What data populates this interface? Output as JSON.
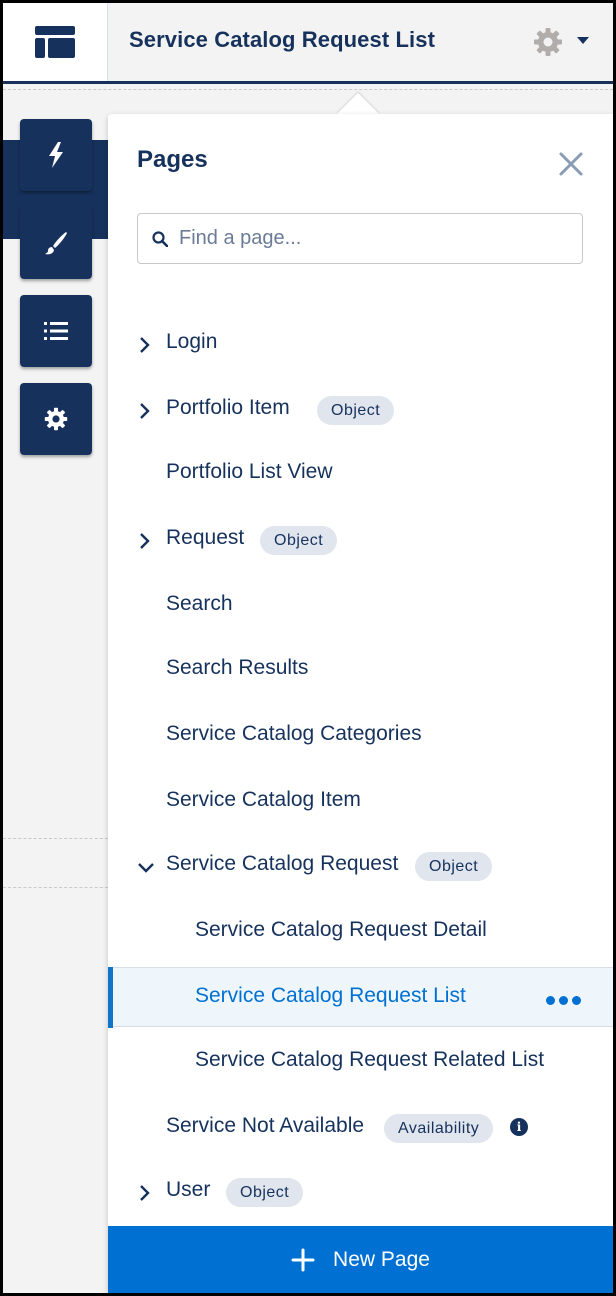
{
  "header": {
    "title": "Service Catalog Request List"
  },
  "toolbar": {
    "buttons": [
      {
        "icon": "lightning-icon"
      },
      {
        "icon": "paintbrush-icon"
      },
      {
        "icon": "list-icon"
      },
      {
        "icon": "gear-icon"
      }
    ]
  },
  "pages_panel": {
    "title": "Pages",
    "search": {
      "placeholder": "Find a page...",
      "value": ""
    },
    "items": [
      {
        "label": "Login",
        "expandable": true,
        "expanded": false,
        "indent": 0
      },
      {
        "label": "Portfolio Item",
        "badge": "Object",
        "expandable": true,
        "expanded": false,
        "indent": 0
      },
      {
        "label": "Portfolio List View",
        "expandable": false,
        "indent": 0
      },
      {
        "label": "Request",
        "badge": "Object",
        "expandable": true,
        "expanded": false,
        "indent": 0
      },
      {
        "label": "Search",
        "expandable": false,
        "indent": 0
      },
      {
        "label": "Search Results",
        "expandable": false,
        "indent": 0
      },
      {
        "label": "Service Catalog Categories",
        "expandable": false,
        "indent": 0
      },
      {
        "label": "Service Catalog Item",
        "expandable": false,
        "indent": 0
      },
      {
        "label": "Service Catalog Request",
        "badge": "Object",
        "expandable": true,
        "expanded": true,
        "indent": 0
      },
      {
        "label": "Service Catalog Request Detail",
        "indent": 1
      },
      {
        "label": "Service Catalog Request List",
        "indent": 1,
        "selected": true
      },
      {
        "label": "Service Catalog Request Related List",
        "indent": 1
      },
      {
        "label": "Service Not Available",
        "badge": "Availability",
        "info_icon": "i",
        "indent": 0
      },
      {
        "label": "User",
        "badge": "Object",
        "expandable": true,
        "expanded": false,
        "indent": 0
      }
    ],
    "new_page_label": "New Page"
  },
  "colors": {
    "navy": "#16325c",
    "brand_blue": "#0070d2",
    "badge_bg": "#e0e5ee",
    "selected_bg": "#eef6fb"
  }
}
